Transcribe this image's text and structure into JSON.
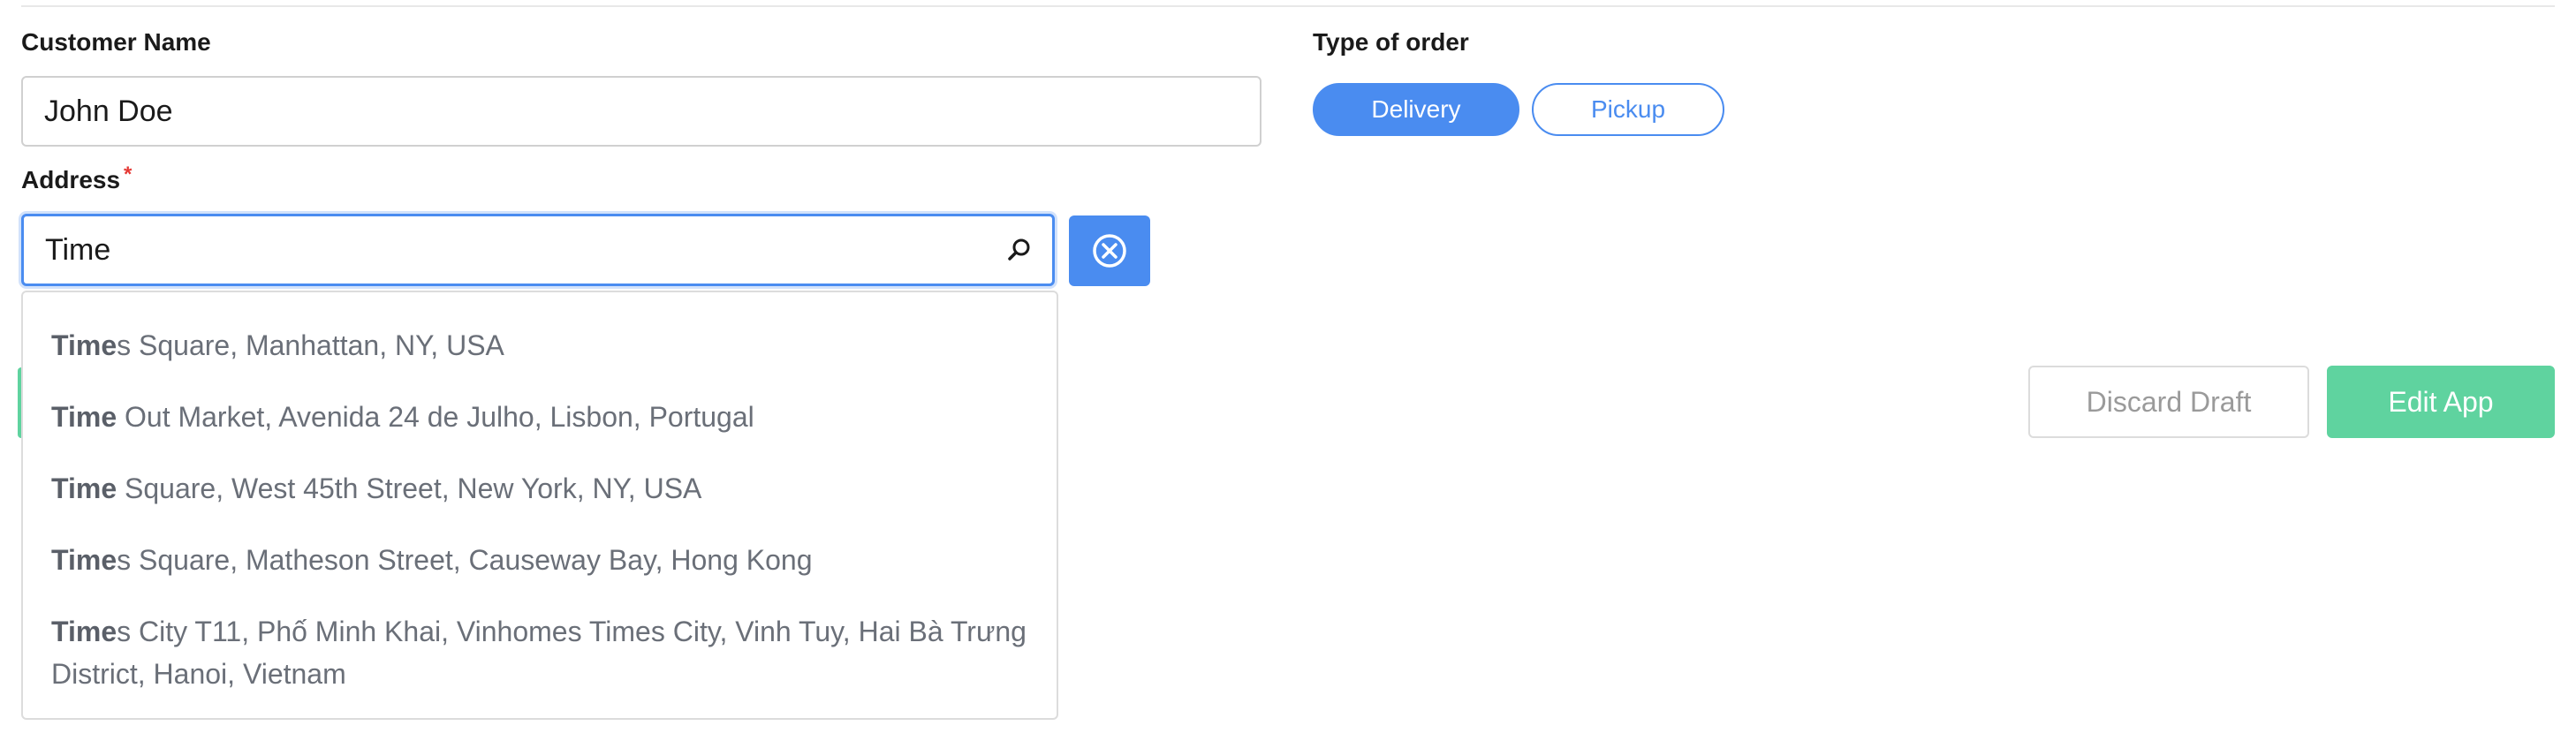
{
  "form": {
    "customer_name_label": "Customer Name",
    "customer_name_value": "John Doe",
    "address_label": "Address",
    "address_required_mark": "*",
    "address_value": "Time",
    "order_type_label": "Type of order",
    "order_type_options": [
      {
        "label": "Delivery",
        "selected": true
      },
      {
        "label": "Pickup",
        "selected": false
      }
    ]
  },
  "icons": {
    "search": "search-icon",
    "clear": "close-circle-icon"
  },
  "suggestions": [
    {
      "match": "Time",
      "rest": "s Square, Manhattan, NY, USA"
    },
    {
      "match": "Time",
      "rest": " Out Market, Avenida 24 de Julho, Lisbon, Portugal"
    },
    {
      "match": "Time",
      "rest": " Square, West 45th Street, New York, NY, USA"
    },
    {
      "match": "Time",
      "rest": "s Square, Matheson Street, Causeway Bay, Hong Kong"
    },
    {
      "match": "Time",
      "rest": "s City T11, Phố Minh Khai, Vinhomes Times City, Vinh Tuy, Hai Bà Trưng District, Hanoi, Vietnam"
    }
  ],
  "actions": {
    "discard_label": "Discard Draft",
    "edit_label": "Edit App"
  },
  "colors": {
    "accent_blue": "#4a8cf0",
    "accent_green": "#5fd39f",
    "required_red": "#e53935"
  }
}
